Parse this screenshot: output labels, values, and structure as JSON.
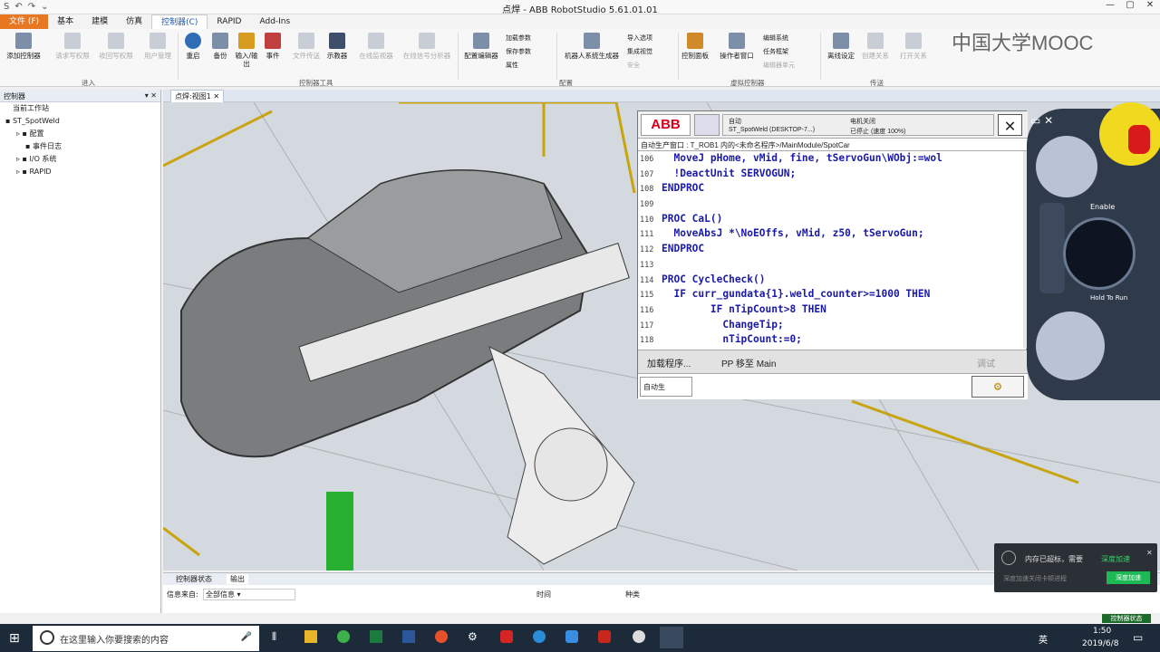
{
  "window": {
    "title": "点焊 - ABB RobotStudio 5.61.01.01",
    "controls": [
      "—",
      "▢",
      "✕"
    ]
  },
  "quick_access": [
    "S",
    "↶",
    "↷",
    "⌄"
  ],
  "menu": {
    "tabs": [
      "文件 (F)",
      "基本",
      "建模",
      "仿真",
      "控制器(C)",
      "RAPID",
      "Add-Ins"
    ]
  },
  "ribbon": {
    "buttons": [
      "添加控制器",
      "请求写权限",
      "收回写权限",
      "用户管理",
      "重启",
      "备份",
      "输入/输出",
      "事件",
      "文件传送",
      "示教器",
      "在线监视器",
      "在线信号分析器",
      "配置编辑器",
      "机器人系统生成器",
      "控制面板",
      "操作者窗口",
      "离线设定",
      "创建关系",
      "打开关系"
    ],
    "small_buttons": [
      "加载参数",
      "保存参数",
      "属性",
      "导入选项",
      "集成视觉",
      "安全",
      "编辑系统",
      "任务框架",
      "编辑器单元"
    ],
    "groups": [
      "进入",
      "控制器工具",
      "配置",
      "虚拟控制器",
      "传送"
    ]
  },
  "left_panel": {
    "header": "控制器",
    "tree": [
      "当前工作站",
      "ST_SpotWeld",
      "配置",
      "事件日志",
      "I/O 系统",
      "RAPID"
    ]
  },
  "view_tab": "点焊:视图1",
  "watermark": "中国大学MOOC",
  "flexpendant": {
    "logo": "ABB",
    "mode": "自动",
    "system": "ST_SpotWeld (DESKTOP-7...)",
    "motor": "电机关闭",
    "state": "已停止 (速度 100%)",
    "path": "自动生产窗口 : T_ROB1 内的<未命名程序>/MainModule/SpotCar",
    "code": [
      {
        "n": "106",
        "t": "  MoveJ pHome, vMid, fine, tServoGun\\WObj:=wol"
      },
      {
        "n": "107",
        "t": "  !DeactUnit SERVOGUN;"
      },
      {
        "n": "108",
        "t": "ENDPROC"
      },
      {
        "n": "109",
        "t": ""
      },
      {
        "n": "110",
        "t": "PROC CaL()"
      },
      {
        "n": "111",
        "t": "  MoveAbsJ *\\NoEOffs, vMid, z50, tServoGun;"
      },
      {
        "n": "112",
        "t": "ENDPROC"
      },
      {
        "n": "113",
        "t": ""
      },
      {
        "n": "114",
        "t": "PROC CycleCheck()"
      },
      {
        "n": "115",
        "t": "  IF curr_gundata{1}.weld_counter>=1000 THEN"
      },
      {
        "n": "116",
        "t": "        IF nTipCount>8 THEN"
      },
      {
        "n": "117",
        "t": "          ChangeTip;"
      },
      {
        "n": "118",
        "t": "          nTipCount:=0;"
      }
    ],
    "load_btn": "加载程序...",
    "pp_btn": "PP 移至 Main",
    "debug_btn": "调试",
    "task_label": "自动生"
  },
  "tpu": {
    "enable": "Enable",
    "hold": "Hold To Run"
  },
  "bottom": {
    "tabs": [
      "控制器状态",
      "输出"
    ],
    "source_label": "信息来自:",
    "source_value": "全部信息",
    "time_col": "时间",
    "type_col": "种类"
  },
  "notice": {
    "title": "内存已超标，需要",
    "link": "深度加速",
    "sub": "深度加速关闭卡顿进程",
    "btn": "深度加速"
  },
  "statusbar": {
    "right": "控制器状态"
  },
  "taskbar": {
    "search": "在这里输入你要搜索的内容",
    "time": "1:50",
    "date": "2019/6/8",
    "lang": "英"
  }
}
